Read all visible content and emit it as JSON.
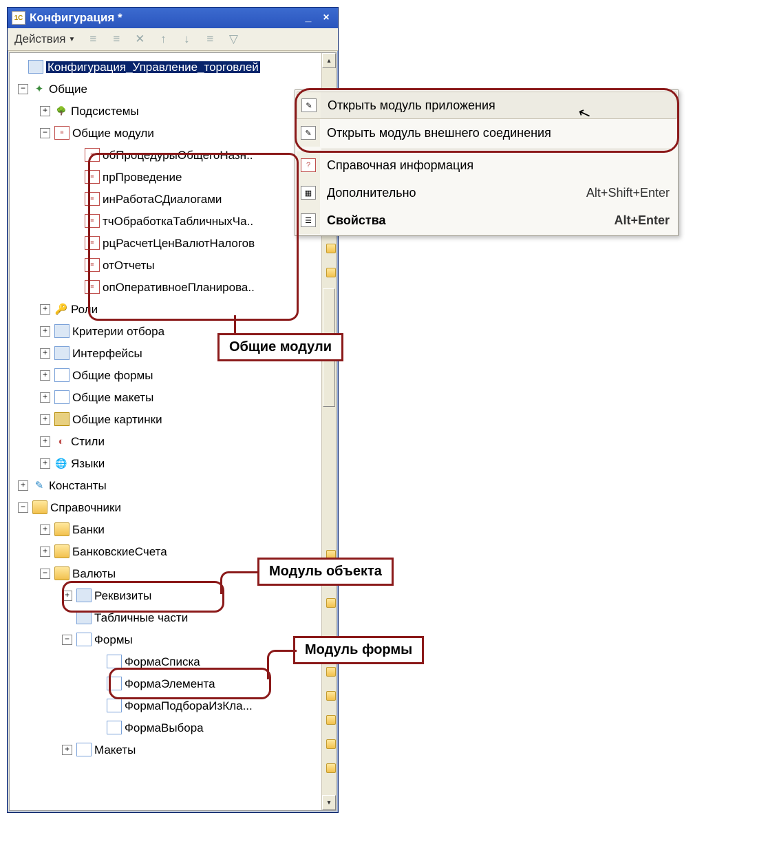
{
  "window": {
    "title": "Конфигурация *"
  },
  "toolbar": {
    "actions_label": "Действия"
  },
  "tree": {
    "root": "Конфигурация_Управление_торговлей",
    "common": "Общие",
    "subsystems": "Подсистемы",
    "common_modules": "Общие модули",
    "modules": {
      "m0": "обПроцедурыОбщегоНазн..",
      "m1": "прПроведение",
      "m2": "инРаботаСДиалогами",
      "m3": "тчОбработкаТабличныхЧа..",
      "m4": "рцРасчетЦенВалютНалогов",
      "m5": "отОтчеты",
      "m6": "опОперативноеПланирова.."
    },
    "roles": "Роли",
    "criteria": "Критерии отбора",
    "interfaces": "Интерфейсы",
    "common_forms": "Общие формы",
    "common_layouts": "Общие макеты",
    "common_pictures": "Общие картинки",
    "styles": "Стили",
    "languages": "Языки",
    "constants": "Константы",
    "catalogs": "Справочники",
    "banks": "Банки",
    "bank_accounts": "БанковскиеСчета",
    "currencies": "Валюты",
    "requisites": "Реквизиты",
    "tabular": "Табличные части",
    "forms": "Формы",
    "form_list": "ФормаСписка",
    "form_element": "ФормаЭлемента",
    "form_pick": "ФормаПодбораИзКла...",
    "form_choice": "ФормаВыбора",
    "layouts": "Макеты"
  },
  "context_menu": {
    "open_app_module": "Открыть модуль приложения",
    "open_ext_module": "Открыть модуль внешнего соединения",
    "help": "Справочная информация",
    "additional": "Дополнительно",
    "additional_shortcut": "Alt+Shift+Enter",
    "properties": "Свойства",
    "properties_shortcut": "Alt+Enter"
  },
  "callouts": {
    "common_modules": "Общие модули",
    "object_module": "Модуль объекта",
    "form_module": "Модуль формы"
  }
}
